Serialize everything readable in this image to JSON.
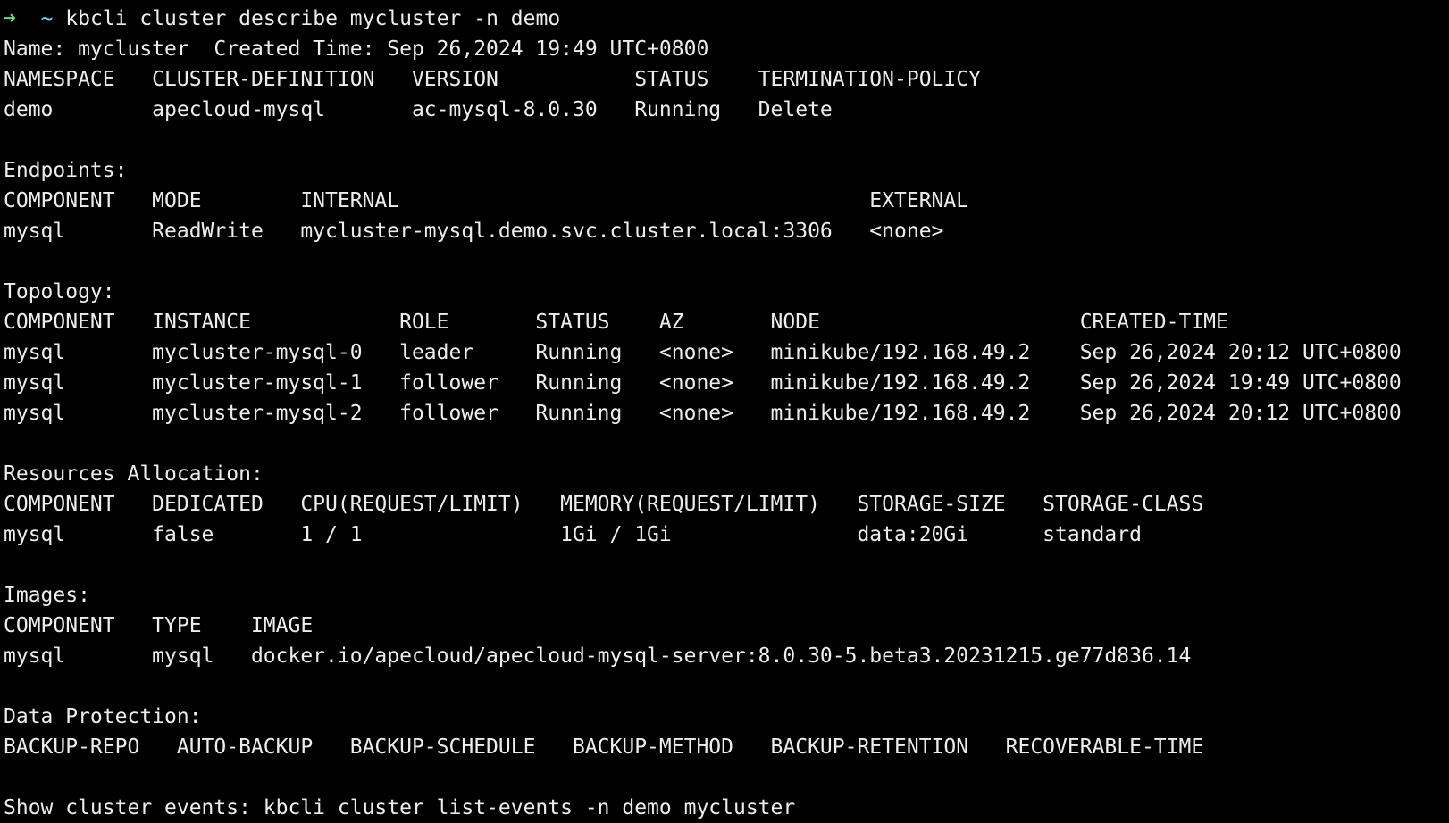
{
  "terminal": {
    "prompt_arrow": "➜",
    "prompt_dir": "~",
    "command": "kbcli cluster describe mycluster -n demo",
    "colors": {
      "background": "#000000",
      "text": "#ededed",
      "arrow": "#5fe07a",
      "tilde": "#5fd7ff"
    }
  },
  "header": {
    "name_line": "Name: mycluster  Created Time: Sep 26,2024 19:49 UTC+0800"
  },
  "cluster_table": {
    "header": "NAMESPACE   CLUSTER-DEFINITION   VERSION           STATUS    TERMINATION-POLICY",
    "rows": [
      "demo        apecloud-mysql       ac-mysql-8.0.30   Running   Delete"
    ]
  },
  "endpoints": {
    "title": "Endpoints:",
    "header": "COMPONENT   MODE        INTERNAL                                      EXTERNAL",
    "rows": [
      "mysql       ReadWrite   mycluster-mysql.demo.svc.cluster.local:3306   <none>"
    ]
  },
  "topology": {
    "title": "Topology:",
    "header": "COMPONENT   INSTANCE            ROLE       STATUS    AZ       NODE                     CREATED-TIME",
    "rows": [
      "mysql       mycluster-mysql-0   leader     Running   <none>   minikube/192.168.49.2    Sep 26,2024 20:12 UTC+0800",
      "mysql       mycluster-mysql-1   follower   Running   <none>   minikube/192.168.49.2    Sep 26,2024 19:49 UTC+0800",
      "mysql       mycluster-mysql-2   follower   Running   <none>   minikube/192.168.49.2    Sep 26,2024 20:12 UTC+0800"
    ]
  },
  "resources": {
    "title": "Resources Allocation:",
    "header": "COMPONENT   DEDICATED   CPU(REQUEST/LIMIT)   MEMORY(REQUEST/LIMIT)   STORAGE-SIZE   STORAGE-CLASS",
    "rows": [
      "mysql       false       1 / 1                1Gi / 1Gi               data:20Gi      standard"
    ]
  },
  "images": {
    "title": "Images:",
    "header": "COMPONENT   TYPE    IMAGE",
    "rows": [
      "mysql       mysql   docker.io/apecloud/apecloud-mysql-server:8.0.30-5.beta3.20231215.ge77d836.14"
    ]
  },
  "data_protection": {
    "title": "Data Protection:",
    "header": "BACKUP-REPO   AUTO-BACKUP   BACKUP-SCHEDULE   BACKUP-METHOD   BACKUP-RETENTION   RECOVERABLE-TIME"
  },
  "footer": {
    "events_hint": "Show cluster events: kbcli cluster list-events -n demo mycluster"
  }
}
